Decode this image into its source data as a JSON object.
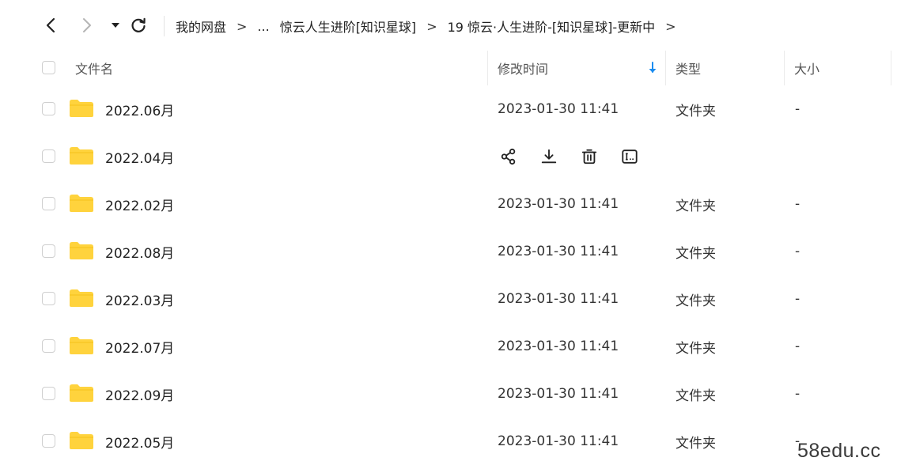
{
  "toolbar": {
    "back_icon": "chevron-left-icon",
    "forward_icon": "chevron-right-icon",
    "dropdown_icon": "caret-down-icon",
    "refresh_icon": "refresh-icon",
    "breadcrumb": [
      "我的网盘",
      "...",
      "惊云人生进阶[知识星球]",
      "19 惊云·人生进阶-[知识星球]-更新中"
    ],
    "breadcrumb_separator": ">"
  },
  "header": {
    "name": "文件名",
    "modified": "修改时间",
    "type": "类型",
    "size": "大小",
    "sort_icon": "sort-down-arrow-icon",
    "sort_color": "#1a8cf0"
  },
  "files": [
    {
      "name": "2022.06月",
      "modified": "2023-01-30 11:41",
      "type": "文件夹",
      "size": "-"
    },
    {
      "name": "2022.04月",
      "modified": "",
      "type": "",
      "size": "",
      "hovered": true
    },
    {
      "name": "2022.02月",
      "modified": "2023-01-30 11:41",
      "type": "文件夹",
      "size": "-"
    },
    {
      "name": "2022.08月",
      "modified": "2023-01-30 11:41",
      "type": "文件夹",
      "size": "-"
    },
    {
      "name": "2022.03月",
      "modified": "2023-01-30 11:41",
      "type": "文件夹",
      "size": "-"
    },
    {
      "name": "2022.07月",
      "modified": "2023-01-30 11:41",
      "type": "文件夹",
      "size": "-"
    },
    {
      "name": "2022.09月",
      "modified": "2023-01-30 11:41",
      "type": "文件夹",
      "size": "-"
    },
    {
      "name": "2022.05月",
      "modified": "2023-01-30 11:41",
      "type": "文件夹",
      "size": "-"
    }
  ],
  "row_actions": [
    "share-icon",
    "download-icon",
    "delete-icon",
    "rename-icon"
  ],
  "folder_color": "#ffd33d",
  "watermark": "58edu.cc"
}
